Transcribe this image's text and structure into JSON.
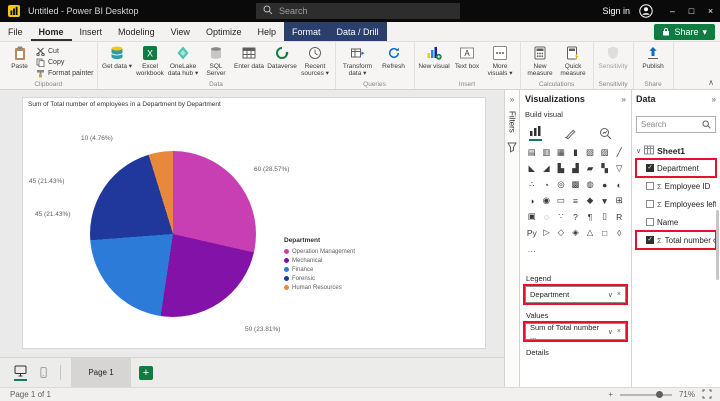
{
  "titlebar": {
    "title": "Untitled - Power BI Desktop",
    "search_placeholder": "Search",
    "sign_in": "Sign in",
    "window": {
      "minimize": "–",
      "maximize": "□",
      "close": "×"
    }
  },
  "ribbon": {
    "tabs": [
      "File",
      "Home",
      "Insert",
      "Modeling",
      "View",
      "Optimize",
      "Help"
    ],
    "contextual_tabs": [
      "Format",
      "Data / Drill"
    ],
    "share_label": "Share",
    "buttons": {
      "paste": "Paste",
      "cut": "Cut",
      "copy": "Copy",
      "format_painter": "Format painter",
      "get_data": "Get data ▾",
      "excel_workbook": "Excel workbook",
      "onelake": "OneLake data hub ▾",
      "sql_server": "SQL Server",
      "enter_data": "Enter data",
      "dataverse": "Dataverse",
      "recent_sources": "Recent sources ▾",
      "transform_data": "Transform data ▾",
      "refresh": "Refresh",
      "new_visual": "New visual",
      "text_box": "Text box",
      "more_visuals": "More visuals ▾",
      "new_measure": "New measure",
      "quick_measure": "Quick measure",
      "sensitivity": "Sensitivity",
      "publish": "Publish"
    },
    "group_labels": {
      "clipboard": "Clipboard",
      "data": "Data",
      "queries": "Queries",
      "insert": "Insert",
      "calculations": "Calculations",
      "sensitivity": "Sensitivity",
      "share": "Share"
    }
  },
  "chart_data": {
    "type": "pie",
    "title": "Sum of Total number of employees in a Department by Department",
    "legend_title": "Department",
    "slices": [
      {
        "label": "Operation Management",
        "value": 60,
        "pct": 28.57,
        "data_label": "60 (28.57%)",
        "color": "#C83FB4"
      },
      {
        "label": "Mechanical",
        "value": 50,
        "pct": 23.81,
        "data_label": "50 (23.81%)",
        "color": "#8312A8"
      },
      {
        "label": "Finance",
        "value": 45,
        "pct": 21.43,
        "data_label": "45 (21.43%)",
        "color": "#2D7BD9"
      },
      {
        "label": "Forensic",
        "value": 45,
        "pct": 21.43,
        "data_label": "45 (21.43%)",
        "color": "#20389B"
      },
      {
        "label": "Human Resources",
        "value": 10,
        "pct": 4.76,
        "data_label": "10 (4.76%)",
        "color": "#E8883C"
      }
    ]
  },
  "filters_panel": {
    "title": "Filters"
  },
  "visualizations_panel": {
    "title": "Visualizations",
    "subtitle": "Build visual",
    "gallery": [
      {
        "name": "stacked-bar-chart",
        "glyph": "▤"
      },
      {
        "name": "clustered-bar-chart",
        "glyph": "▥"
      },
      {
        "name": "stacked-column-chart",
        "glyph": "▦"
      },
      {
        "name": "clustered-column-chart",
        "glyph": "▮"
      },
      {
        "name": "100-stacked-bar-chart",
        "glyph": "▧"
      },
      {
        "name": "100-stacked-column-chart",
        "glyph": "▨"
      },
      {
        "name": "line-chart",
        "glyph": "╱"
      },
      {
        "name": "area-chart",
        "glyph": "◣"
      },
      {
        "name": "stacked-area-chart",
        "glyph": "◢"
      },
      {
        "name": "line-and-stacked-column-chart",
        "glyph": "▙"
      },
      {
        "name": "line-and-clustered-column-chart",
        "glyph": "▟"
      },
      {
        "name": "ribbon-chart",
        "glyph": "▰"
      },
      {
        "name": "waterfall-chart",
        "glyph": "▚"
      },
      {
        "name": "funnel-chart",
        "glyph": "▽"
      },
      {
        "name": "scatter-chart",
        "glyph": "∴"
      },
      {
        "name": "pie-chart",
        "glyph": "◔"
      },
      {
        "name": "donut-chart",
        "glyph": "◎"
      },
      {
        "name": "treemap",
        "glyph": "▩"
      },
      {
        "name": "map",
        "glyph": "◍"
      },
      {
        "name": "filled-map",
        "glyph": "●"
      },
      {
        "name": "shape-map",
        "glyph": "◐"
      },
      {
        "name": "azure-map",
        "glyph": "◑"
      },
      {
        "name": "gauge",
        "glyph": "◉"
      },
      {
        "name": "card",
        "glyph": "▭"
      },
      {
        "name": "multi-row-card",
        "glyph": "≡"
      },
      {
        "name": "kpi",
        "glyph": "◆"
      },
      {
        "name": "slicer",
        "glyph": "▼"
      },
      {
        "name": "table",
        "glyph": "⊞"
      },
      {
        "name": "matrix",
        "glyph": "▣"
      },
      {
        "name": "key-influencers",
        "glyph": "◌"
      },
      {
        "name": "decomposition-tree",
        "glyph": "∵"
      },
      {
        "name": "qa-visual",
        "glyph": "?"
      },
      {
        "name": "smart-narrative",
        "glyph": "¶"
      },
      {
        "name": "paginated-report",
        "glyph": "▯"
      },
      {
        "name": "r-script-visual",
        "glyph": "R"
      },
      {
        "name": "python-visual",
        "glyph": "Py"
      },
      {
        "name": "power-apps-visual",
        "glyph": "▷"
      },
      {
        "name": "power-automate-visual",
        "glyph": "◇"
      },
      {
        "name": "arcgis-map",
        "glyph": "◈"
      },
      {
        "name": "metrics",
        "glyph": "△"
      },
      {
        "name": "scorecard",
        "glyph": "□"
      },
      {
        "name": "performance-flow",
        "glyph": "◊"
      },
      {
        "name": "more-visuals-option",
        "glyph": "…"
      }
    ],
    "wells": {
      "legend_label": "Legend",
      "legend_value": "Department",
      "values_label": "Values",
      "values_value": "Sum of Total number ...",
      "details_label": "Details"
    }
  },
  "data_panel": {
    "title": "Data",
    "search_placeholder": "Search",
    "table_name": "Sheet1",
    "fields": [
      {
        "name": "Department",
        "checked": true,
        "numeric": false,
        "annotated": true
      },
      {
        "name": "Employee ID",
        "checked": false,
        "numeric": true,
        "annotated": false
      },
      {
        "name": "Employees left t...",
        "checked": false,
        "numeric": true,
        "annotated": false
      },
      {
        "name": "Name",
        "checked": false,
        "numeric": false,
        "annotated": false
      },
      {
        "name": "Total number of .",
        "checked": true,
        "numeric": true,
        "annotated": true
      }
    ]
  },
  "footer": {
    "page_tab": "Page 1",
    "status_left": "Page 1 of 1",
    "zoom": "71%"
  },
  "icons": {
    "sigma": "Σ",
    "chevron_down": "∨",
    "chevron_up": "∧",
    "collapse_right": "»",
    "remove": "×",
    "dropdown": "▾",
    "check": "✓",
    "plus": "+"
  },
  "colors": {
    "annotation": "#E8112D",
    "contextual_tab": "#2B3F6C",
    "share_green": "#107C41",
    "active_mode_underline": "#117865"
  }
}
